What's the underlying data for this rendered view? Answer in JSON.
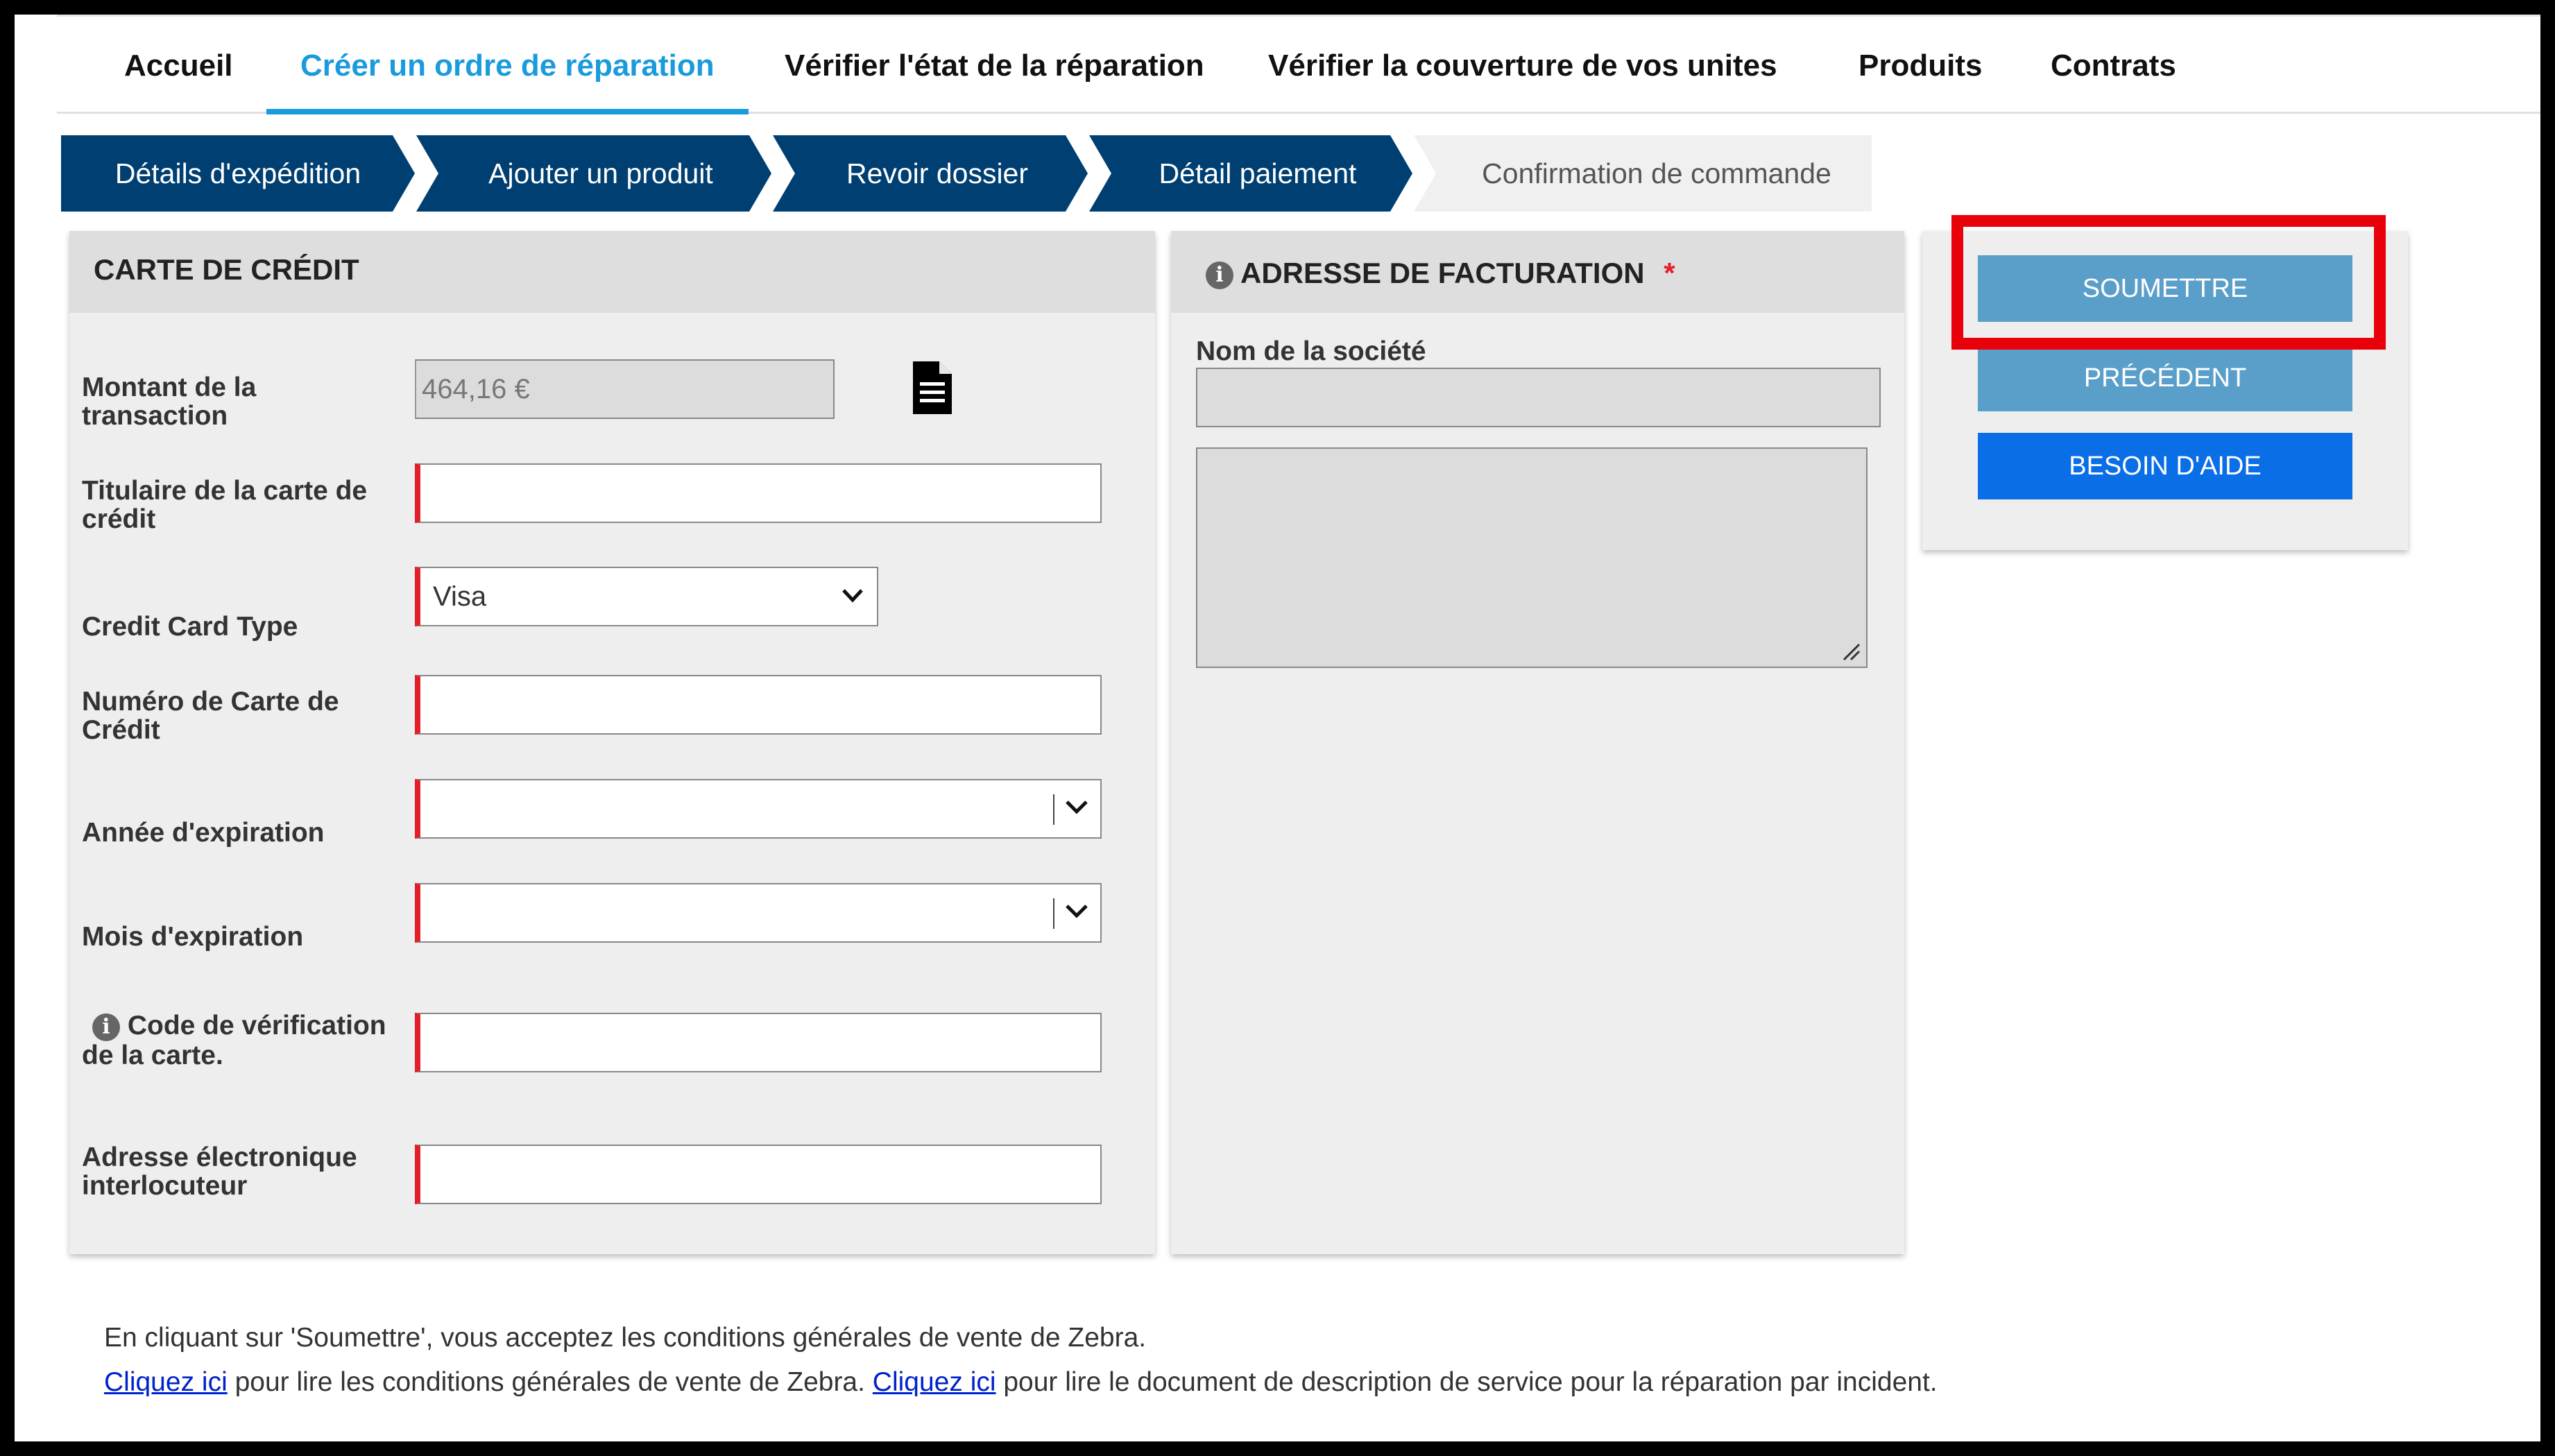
{
  "nav": [
    {
      "label": "Accueil",
      "active": false
    },
    {
      "label": "Créer un ordre de réparation",
      "active": true
    },
    {
      "label": "Vérifier l'état de la réparation",
      "active": false
    },
    {
      "label": "Vérifier la couverture de vos unites",
      "active": false
    },
    {
      "label": "Produits",
      "active": false
    },
    {
      "label": "Contrats",
      "active": false
    }
  ],
  "steps": [
    {
      "label": "Détails d'expédition"
    },
    {
      "label": "Ajouter un produit"
    },
    {
      "label": "Revoir dossier"
    },
    {
      "label": "Détail paiement"
    },
    {
      "label": "Confirmation de commande"
    }
  ],
  "credit_card": {
    "title": "CARTE DE CRÉDIT",
    "amount_label": "Montant de la transaction",
    "amount_value": "464,16 €",
    "holder_label": "Titulaire de la carte de crédit",
    "type_label": "Credit Card Type",
    "type_value": "Visa",
    "number_label": "Numéro de Carte de Crédit",
    "year_label": "Année d'expiration",
    "month_label": "Mois d'expiration",
    "cvv_label": "Code de vérification de la carte.",
    "email_label": "Adresse électronique interlocuteur"
  },
  "billing": {
    "title": "ADRESSE DE FACTURATION",
    "required_mark": "*",
    "company_label": "Nom de la société"
  },
  "actions": {
    "submit": "SOUMETTRE",
    "previous": "PRÉCÉDENT",
    "help": "BESOIN D'AIDE"
  },
  "footer": {
    "line1": "En cliquant sur 'Soumettre', vous acceptez les conditions générales de vente de Zebra.",
    "link1": "Cliquez ici",
    "text1": " pour lire les conditions générales de vente de Zebra. ",
    "link2": "Cliquez ici",
    "text2": " pour lire le document de description de service pour la réparation par incident."
  },
  "colors": {
    "accent": "#1a9bdc",
    "step_bg": "#003f72",
    "required": "#e3202a",
    "submit": "#5a9fca",
    "help": "#0a6ee6",
    "highlight": "#e8000b"
  }
}
